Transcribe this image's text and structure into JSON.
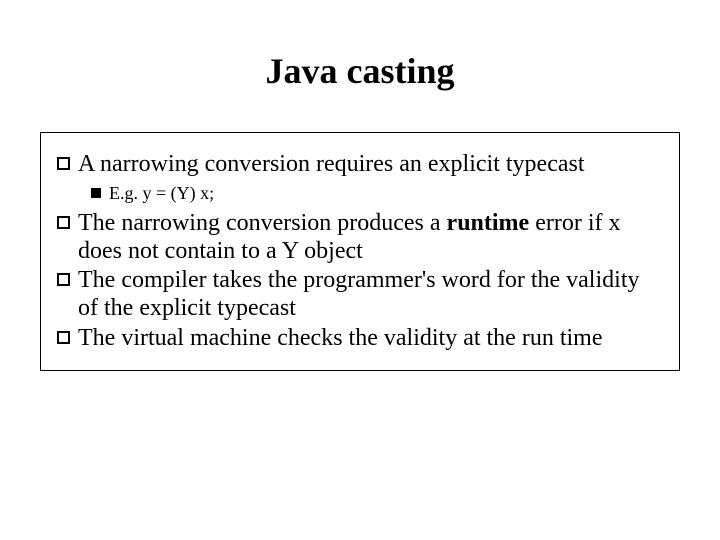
{
  "title": "Java casting",
  "items": [
    {
      "level": 1,
      "text": "A narrowing conversion requires an explicit typecast"
    },
    {
      "level": 2,
      "text": "E.g. y = (Y) x;"
    },
    {
      "level": 1,
      "pre": "The narrowing conversion produces a ",
      "bold": "runtime",
      "post": " error if x does not contain to a Y object"
    },
    {
      "level": 1,
      "text": "The compiler takes the programmer's word for the validity of the explicit typecast"
    },
    {
      "level": 1,
      "text": "The virtual machine checks the validity at the run time"
    }
  ]
}
